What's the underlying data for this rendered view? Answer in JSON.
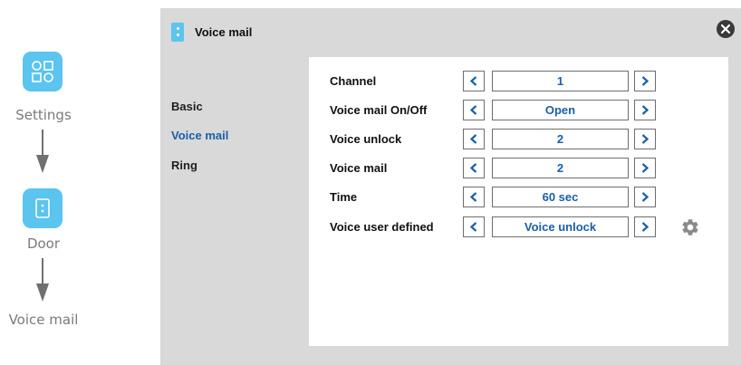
{
  "guide": {
    "steps": [
      {
        "label": "Settings",
        "icon": "settings-grid-icon"
      },
      {
        "label": "Door",
        "icon": "door-icon"
      },
      {
        "label": "Voice mail"
      }
    ],
    "arrow_icon": "down-arrow-icon",
    "accent_color": "#5bc4ef"
  },
  "window": {
    "title": "Voice mail",
    "title_icon": "door-icon",
    "close_icon": "close-icon"
  },
  "sidebar": {
    "items": [
      {
        "label": "Basic",
        "active": false
      },
      {
        "label": "Voice mail",
        "active": true
      },
      {
        "label": "Ring",
        "active": false
      }
    ]
  },
  "settings": {
    "rows": [
      {
        "label": "Channel",
        "value": "1"
      },
      {
        "label": "Voice mail On/Off",
        "value": "Open"
      },
      {
        "label": "Voice unlock",
        "value": "2"
      },
      {
        "label": "Voice mail",
        "value": "2"
      },
      {
        "label": "Time",
        "value": "60 sec"
      },
      {
        "label": "Voice user defined",
        "value": "Voice unlock",
        "has_gear": true
      }
    ],
    "prev_icon": "chevron-left-icon",
    "next_icon": "chevron-right-icon",
    "gear_icon": "gear-icon"
  },
  "colors": {
    "value_text": "#1a5fa8",
    "active_menu": "#1a5fa8",
    "window_bg": "#d9d9d9"
  }
}
